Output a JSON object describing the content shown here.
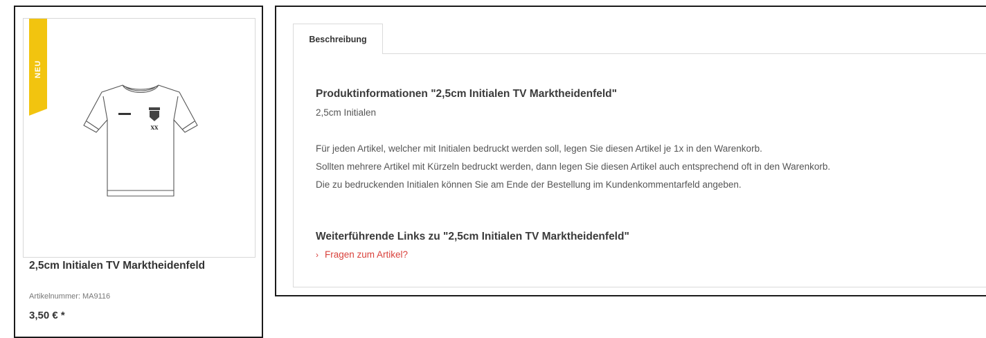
{
  "product_card": {
    "badge": "NEU",
    "title": "2,5cm Initialen TV Marktheidenfeld",
    "sku": "Artikelnummer: MA9116",
    "price": "3,50 € *",
    "image": {
      "icon": "tshirt-icon",
      "print_text": "XX"
    },
    "badge_color": "#f2c40f"
  },
  "description_panel": {
    "tab_label": "Beschreibung",
    "heading": "Produktinformationen \"2,5cm Initialen TV Marktheidenfeld\"",
    "subtitle": "2,5cm Initialen",
    "paragraphs": [
      "Für jeden Artikel, welcher mit Initialen bedruckt werden soll, legen Sie diesen Artikel je 1x in den Warenkorb.",
      "Sollten mehrere Artikel mit Kürzeln bedruckt werden, dann legen Sie diesen Artikel auch entsprechend oft in den Warenkorb.",
      "Die zu bedruckenden Initialen können Sie am Ende der Bestellung im Kundenkommentarfeld angeben."
    ],
    "links_heading": "Weiterführende Links zu \"2,5cm Initialen TV Marktheidenfeld\"",
    "link_label": "Fragen zum Artikel?",
    "link_icon": "chevron-right-icon",
    "link_color": "#d9413b"
  }
}
